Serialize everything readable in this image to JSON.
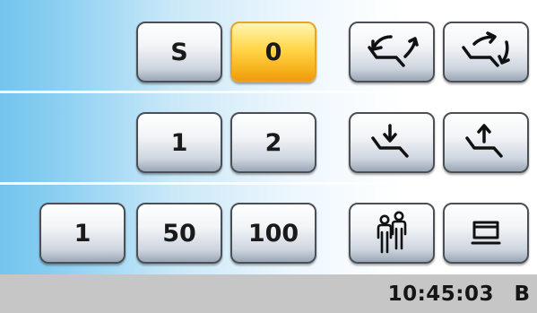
{
  "row1": {
    "s_label": "S",
    "zero_label": "0",
    "recline_left_icon": "chair-tilt-backward-icon",
    "recline_right_icon": "chair-tilt-forward-icon"
  },
  "row2": {
    "one_label": "1",
    "two_label": "2",
    "lower_icon": "chair-down-icon",
    "raise_icon": "chair-up-icon"
  },
  "row3": {
    "step1_label": "1",
    "step50_label": "50",
    "step100_label": "100",
    "people_icon": "people-icon",
    "display_icon": "screen-icon"
  },
  "status": {
    "time": "10:45:03",
    "mode": "B"
  },
  "colors": {
    "active_button": "#f7b21c",
    "panel_gradient_left": "#73c4ee",
    "status_bar": "#c6c6c6"
  }
}
